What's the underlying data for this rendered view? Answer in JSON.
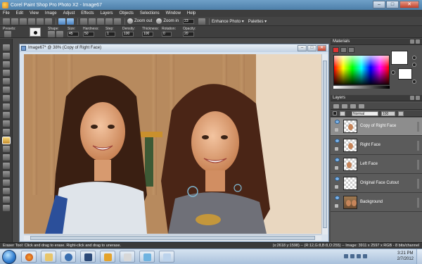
{
  "window": {
    "title": "Corel Paint Shop Pro Photo X2 - Image67",
    "min": "–",
    "max": "□",
    "close": "✕"
  },
  "menu": [
    "File",
    "Edit",
    "View",
    "Image",
    "Adjust",
    "Effects",
    "Layers",
    "Objects",
    "Selections",
    "Window",
    "Help"
  ],
  "toolbar": {
    "zoom_out": "Zoom out",
    "zoom_in": "Zoom in",
    "zoom_value": "23",
    "enhance_photo": "Enhance Photo ▾",
    "palettes": "Palettes ▾"
  },
  "tool_options": {
    "presets_label": "Presets:",
    "shape_label": "Shape:",
    "size_label": "Size:",
    "size_value": "45",
    "hardness_label": "Hardness:",
    "hardness_value": "50",
    "step_label": "Step:",
    "step_value": "1",
    "density_label": "Density:",
    "density_value": "100",
    "thickness_label": "Thickness:",
    "thickness_value": "100",
    "rotation_label": "Rotation:",
    "rotation_value": "0",
    "opacity_label": "Opacity:",
    "opacity_value": "20"
  },
  "image_window": {
    "title": "Image67* @ 38% (Copy of Right Face)"
  },
  "materials": {
    "title": "Materials"
  },
  "layers_panel": {
    "title": "Layers",
    "blend_mode": "Normal",
    "opacity": "100",
    "layers": [
      {
        "name": "Copy of Right Face",
        "selected": true
      },
      {
        "name": "Right Face",
        "selected": false
      },
      {
        "name": "Left Face",
        "selected": false
      },
      {
        "name": "Original Face Cutout",
        "selected": false
      },
      {
        "name": "Background",
        "selected": false
      }
    ]
  },
  "status": {
    "left": "Eraser Tool: Click and drag to erase. Right-click and drag to unerase.",
    "right": "(x:2618 y:1598) -- (R:12,G:8,B:8,O:255) -- Image: 3911 x 2597 x RGB - 8 bits/channel"
  },
  "taskbar": {
    "time": "3:21 PM",
    "date": "2/7/2012"
  },
  "colors": {
    "accent": "#4d7fa9",
    "selected_layer": "#8d8d8d",
    "canvas_wood": "#a07a52"
  }
}
